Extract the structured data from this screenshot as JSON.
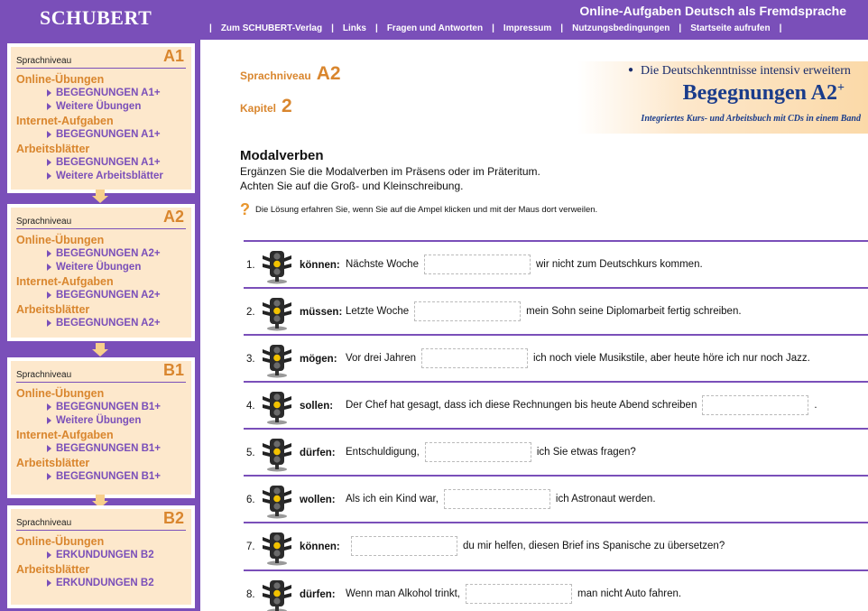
{
  "header": {
    "logo": "SCHUBERT",
    "title": "Online-Aufgaben Deutsch als Fremdsprache",
    "nav": [
      "Zum SCHUBERT-Verlag",
      "Links",
      "Fragen und Antworten",
      "Impressum",
      "Nutzungsbedingungen",
      "Startseite aufrufen"
    ],
    "sep": "|"
  },
  "sidebar": {
    "levels": [
      {
        "label": "Sprachniveau",
        "code": "A1",
        "sections": [
          {
            "title": "Online-Übungen",
            "links": [
              "BEGEGNUNGEN A1+",
              "Weitere Übungen"
            ]
          },
          {
            "title": "Internet-Aufgaben",
            "links": [
              "BEGEGNUNGEN A1+"
            ]
          },
          {
            "title": "Arbeitsblätter",
            "links": [
              "BEGEGNUNGEN A1+",
              "Weitere Arbeitsblätter"
            ]
          }
        ]
      },
      {
        "label": "Sprachniveau",
        "code": "A2",
        "sections": [
          {
            "title": "Online-Übungen",
            "links": [
              "BEGEGNUNGEN A2+",
              "Weitere Übungen"
            ]
          },
          {
            "title": "Internet-Aufgaben",
            "links": [
              "BEGEGNUNGEN A2+"
            ]
          },
          {
            "title": "Arbeitsblätter",
            "links": [
              "BEGEGNUNGEN A2+"
            ]
          }
        ]
      },
      {
        "label": "Sprachniveau",
        "code": "B1",
        "sections": [
          {
            "title": "Online-Übungen",
            "links": [
              "BEGEGNUNGEN B1+",
              "Weitere Übungen"
            ]
          },
          {
            "title": "Internet-Aufgaben",
            "links": [
              "BEGEGNUNGEN B1+"
            ]
          },
          {
            "title": "Arbeitsblätter",
            "links": [
              "BEGEGNUNGEN B1+"
            ]
          }
        ]
      },
      {
        "label": "Sprachniveau",
        "code": "B2",
        "sections": [
          {
            "title": "Online-Übungen",
            "links": [
              "ERKUNDUNGEN B2"
            ]
          },
          {
            "title": "Arbeitsblätter",
            "links": [
              "ERKUNDUNGEN B2"
            ]
          }
        ]
      }
    ]
  },
  "main": {
    "level_label": "Sprachniveau",
    "level_code": "A2",
    "kapitel_label": "Kapitel",
    "kapitel_num": "2",
    "banner": {
      "tagline": "Die Deutschkenntnisse intensiv erweitern",
      "title": "Begegnungen A2",
      "title_sup": "+",
      "subtitle": "Integriertes Kurs- und Arbeitsbuch mit CDs in einem Band"
    },
    "exercise_title": "Modalverben",
    "instruction_1": "Ergänzen Sie die Modalverben im Präsens oder im Präteritum.",
    "instruction_2": "Achten Sie auf die Groß- und Kleinschreibung.",
    "hint_icon": "?",
    "hint": "Die Lösung erfahren Sie, wenn Sie auf die Ampel klicken und mit der Maus dort verweilen.",
    "items": [
      {
        "num": "1.",
        "verb": "können:",
        "before": "Nächste Woche",
        "after": "wir nicht zum Deutschkurs kommen."
      },
      {
        "num": "2.",
        "verb": "müssen:",
        "before": "Letzte Woche",
        "after": "mein Sohn seine Diplomarbeit fertig schreiben."
      },
      {
        "num": "3.",
        "verb": "mögen:",
        "before": "Vor drei Jahren",
        "after": "ich noch viele Musikstile, aber heute höre ich nur noch Jazz."
      },
      {
        "num": "4.",
        "verb": "sollen:",
        "before": "Der Chef hat gesagt, dass ich diese Rechnungen bis heute Abend schreiben",
        "after": "."
      },
      {
        "num": "5.",
        "verb": "dürfen:",
        "before": "Entschuldigung,",
        "after": "ich Sie etwas fragen?"
      },
      {
        "num": "6.",
        "verb": "wollen:",
        "before": "Als ich ein Kind war,",
        "after": "ich Astronaut werden."
      },
      {
        "num": "7.",
        "verb": "können:",
        "before": "",
        "after": "du mir helfen, diesen Brief ins Spanische zu übersetzen?"
      },
      {
        "num": "8.",
        "verb": "dürfen:",
        "before": "Wenn man Alkohol trinkt,",
        "after": "man nicht Auto fahren."
      }
    ]
  },
  "colors": {
    "purple": "#7a4fb9",
    "orange": "#d9862e",
    "peach": "#fde8cc",
    "navy": "#1a3c8b"
  },
  "icons": {
    "lamp": "traffic-light-icon",
    "hint": "question-mark-icon",
    "bullet": "triangle-bullet-icon",
    "arrow": "down-arrow-icon"
  }
}
